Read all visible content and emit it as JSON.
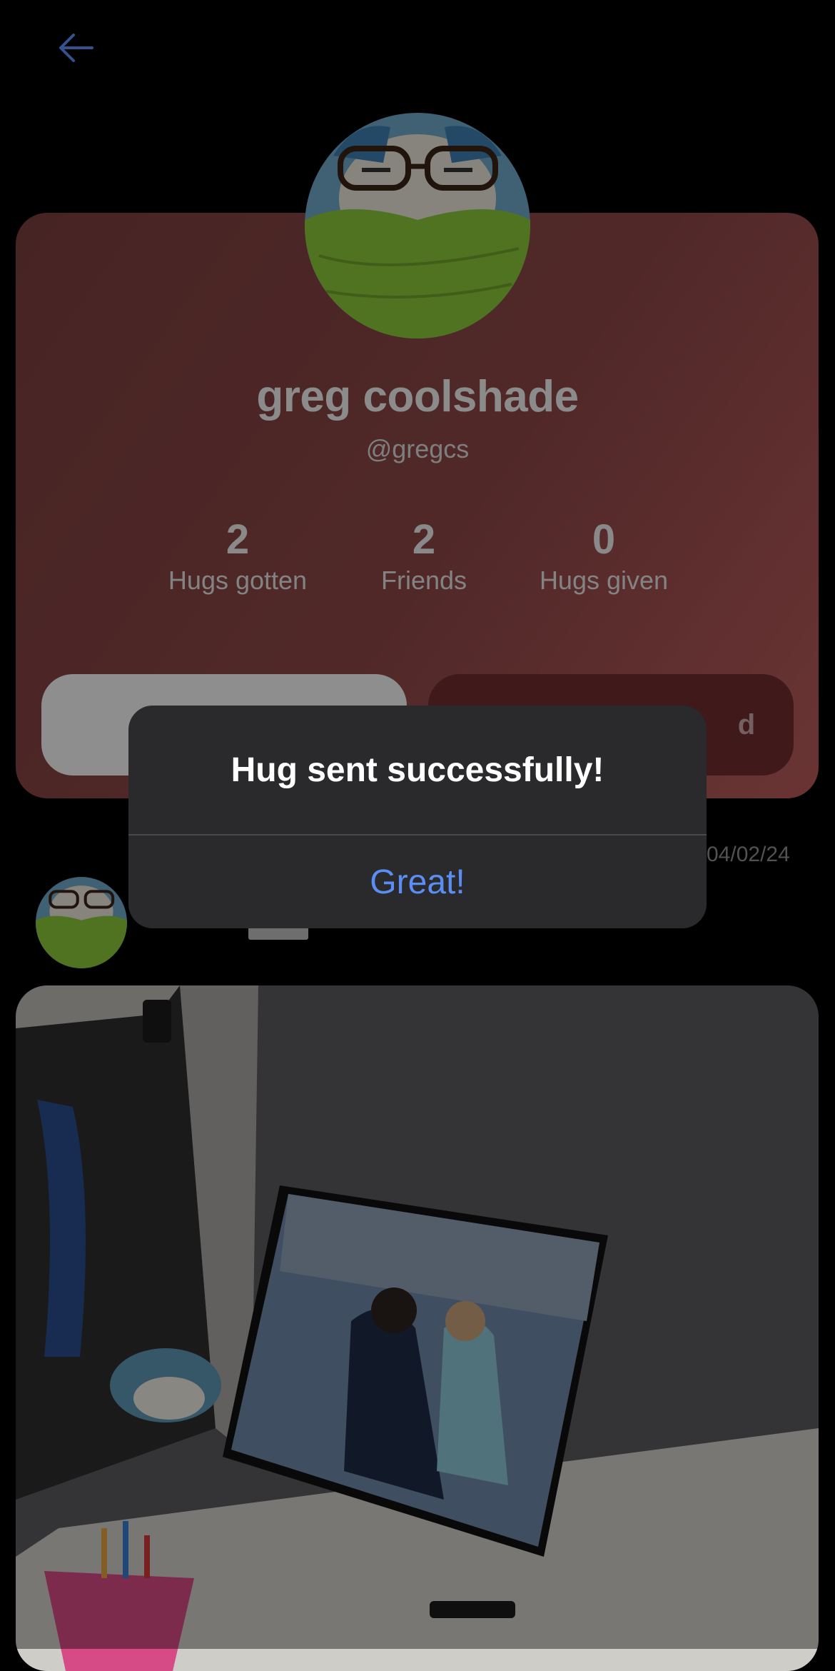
{
  "profile": {
    "display_name": "greg coolshade",
    "username": "@gregcs",
    "stats": [
      {
        "value": "2",
        "label": "Hugs gotten"
      },
      {
        "value": "2",
        "label": "Friends"
      },
      {
        "value": "0",
        "label": "Hugs given"
      }
    ],
    "secondary_button_partial": "d"
  },
  "post": {
    "date": "04/02/24"
  },
  "alert": {
    "title": "Hug sent successfully!",
    "button_label": "Great!"
  },
  "colors": {
    "accent": "#5b8ef5",
    "card_gradient_start": "#7a3f3e",
    "card_gradient_end": "#b85a5a"
  },
  "icons": {
    "back": "arrow-left-icon"
  }
}
